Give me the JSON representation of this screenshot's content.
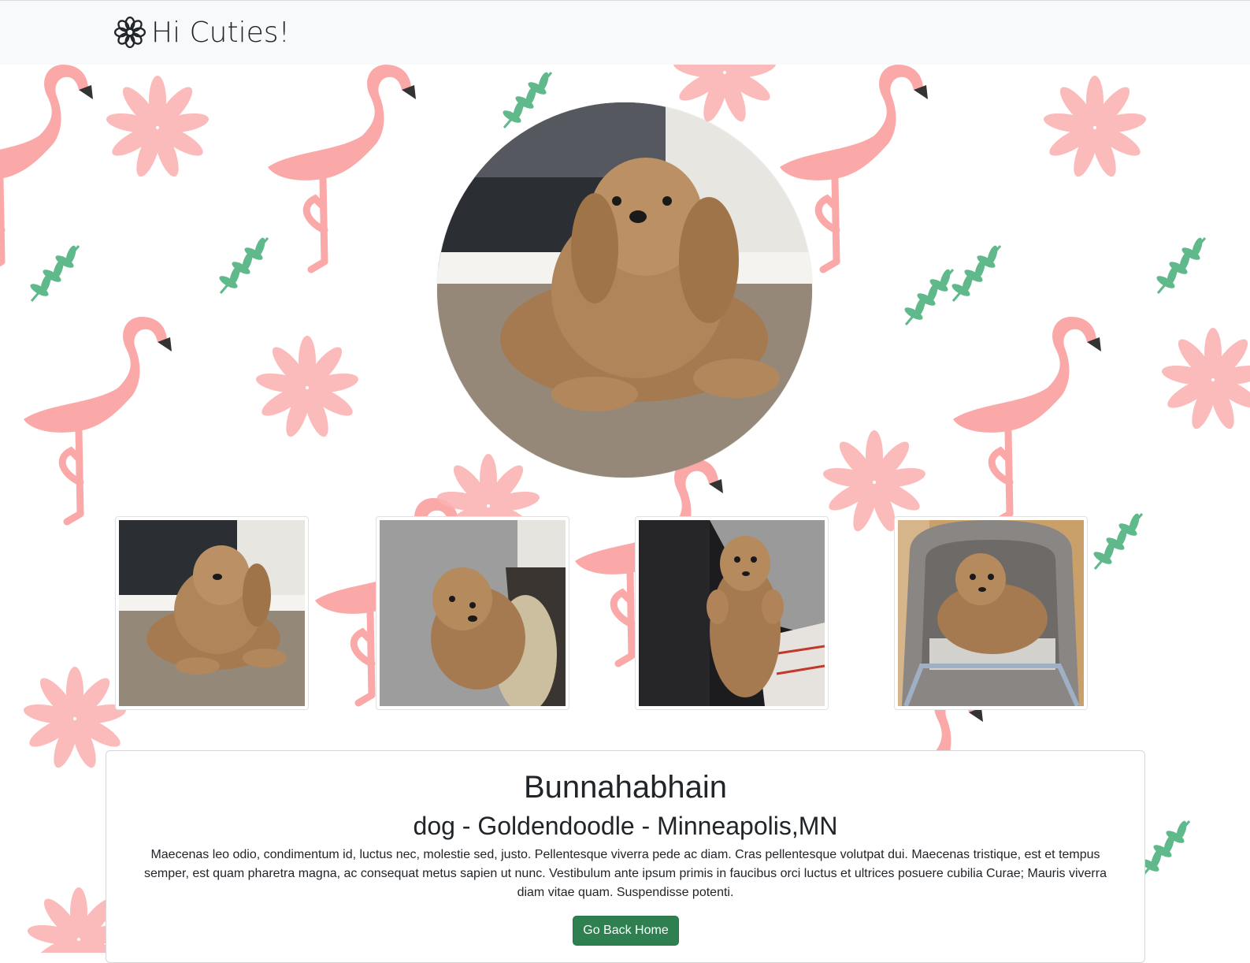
{
  "navbar": {
    "brand_icon": "flower-icon",
    "brand_text": "Hi Cuties!"
  },
  "background": {
    "pattern": "flamingo-and-palm-leaf",
    "colors": {
      "flamingo": "#fba8a8",
      "leaf": "#5fb98a",
      "beak": "#333333"
    }
  },
  "pet": {
    "name": "Bunnahabhain",
    "details": "dog - Goldendoodle - Minneapolis,MN",
    "description": "Maecenas leo odio, condimentum id, luctus nec, molestie sed, justo. Pellentesque viverra pede ac diam. Cras pellentesque volutpat dui. Maecenas tristique, est et tempus semper, est quam pharetra magna, ac consequat metus sapien ut nunc. Vestibulum ante ipsum primis in faucibus orci luctus et ultrices posuere cubilia Curae; Mauris viverra diam vitae quam. Suspendisse potenti."
  },
  "actions": {
    "go_back_label": "Go Back Home",
    "button_color": "#2e8050"
  },
  "photos": {
    "hero": "dog-lying-on-carpet-photo",
    "thumbnails": [
      "dog-lying-on-carpet-photo",
      "dog-in-bed-photo",
      "dog-on-couch-photo",
      "dog-in-carrier-photo"
    ]
  }
}
